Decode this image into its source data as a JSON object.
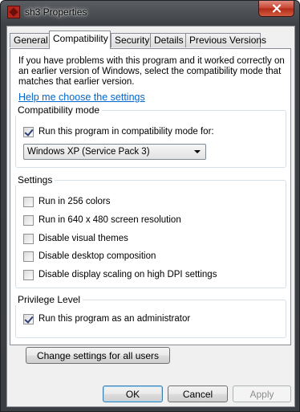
{
  "window": {
    "title": "sh3 Properties",
    "app_icon": "app-icon",
    "close_icon": "close-icon"
  },
  "tabs": [
    {
      "label": "General",
      "active": false
    },
    {
      "label": "Compatibility",
      "active": true
    },
    {
      "label": "Security",
      "active": false
    },
    {
      "label": "Details",
      "active": false
    },
    {
      "label": "Previous Versions",
      "active": false
    }
  ],
  "intro_text": "If you have problems with this program and it worked correctly on an earlier version of Windows, select the compatibility mode that matches that earlier version.",
  "help_link": "Help me choose the settings",
  "compat_group": {
    "legend": "Compatibility mode",
    "checkbox_label": "Run this program in compatibility mode for:",
    "checked": true,
    "selected_mode": "Windows XP (Service Pack 3)"
  },
  "settings_group": {
    "legend": "Settings",
    "options": [
      {
        "label": "Run in 256 colors",
        "checked": false
      },
      {
        "label": "Run in 640 x 480 screen resolution",
        "checked": false
      },
      {
        "label": "Disable visual themes",
        "checked": false
      },
      {
        "label": "Disable desktop composition",
        "checked": false
      },
      {
        "label": "Disable display scaling on high DPI settings",
        "checked": false
      }
    ]
  },
  "privilege_group": {
    "legend": "Privilege Level",
    "checkbox_label": "Run this program as an administrator",
    "checked": true
  },
  "buttons": {
    "change_all_users": "Change settings for all users",
    "ok": "OK",
    "cancel": "Cancel",
    "apply": "Apply"
  }
}
